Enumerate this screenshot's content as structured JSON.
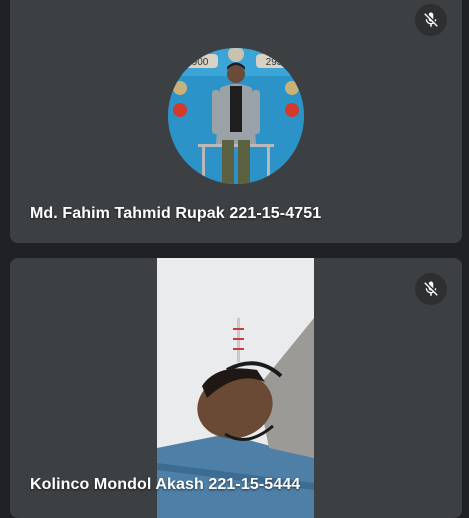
{
  "participants": [
    {
      "name": "Md. Fahim Tahmid Rupak 221-15-4751",
      "mic_icon": "mic-off-icon",
      "media": "avatar"
    },
    {
      "name": "Kolinco Mondol Akash 221-15-5444",
      "mic_icon": "mic-off-icon",
      "media": "video"
    }
  ],
  "colors": {
    "page_background": "#202124",
    "tile_background": "#3c4043",
    "mute_button_background": "#2d2f31",
    "name_text": "#ffffff"
  }
}
